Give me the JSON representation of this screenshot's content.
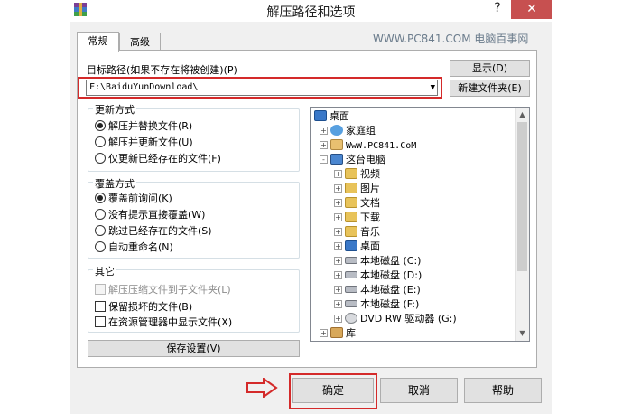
{
  "window": {
    "title": "解压路径和选项",
    "help_glyph": "?",
    "close_glyph": "✕"
  },
  "watermark": "WWW.PC841.COM 电脑百事网",
  "tabs": [
    {
      "label": "常规",
      "active": true
    },
    {
      "label": "高级",
      "active": false
    }
  ],
  "path": {
    "label": "目标路径(如果不存在将被创建)(P)",
    "value": "F:\\BaiduYunDownload\\",
    "show_button": "显示(D)",
    "new_folder_button": "新建文件夹(E)"
  },
  "update_mode": {
    "title": "更新方式",
    "options": [
      {
        "label": "解压并替换文件(R)",
        "selected": true
      },
      {
        "label": "解压并更新文件(U)",
        "selected": false
      },
      {
        "label": "仅更新已经存在的文件(F)",
        "selected": false
      }
    ]
  },
  "overwrite_mode": {
    "title": "覆盖方式",
    "options": [
      {
        "label": "覆盖前询问(K)",
        "selected": true
      },
      {
        "label": "没有提示直接覆盖(W)",
        "selected": false
      },
      {
        "label": "跳过已经存在的文件(S)",
        "selected": false
      },
      {
        "label": "自动重命名(N)",
        "selected": false
      }
    ]
  },
  "other": {
    "title": "其它",
    "options": [
      {
        "label": "解压压缩文件到子文件夹(L)",
        "checked": false,
        "disabled": true
      },
      {
        "label": "保留损坏的文件(B)",
        "checked": false,
        "disabled": false
      },
      {
        "label": "在资源管理器中显示文件(X)",
        "checked": false,
        "disabled": false
      }
    ]
  },
  "save_settings_button": "保存设置(V)",
  "tree": {
    "items": [
      {
        "label": "桌面",
        "icon": "desktop-icon"
      },
      {
        "label": "家庭组",
        "icon": "homegroup-icon",
        "expander": "+"
      },
      {
        "label": "WwW.PC841.CoM",
        "icon": "user-icon",
        "expander": "+"
      },
      {
        "label": "这台电脑",
        "icon": "computer-icon",
        "expander": "-"
      },
      {
        "label": "视频",
        "icon": "folder-icon",
        "expander": "+"
      },
      {
        "label": "图片",
        "icon": "folder-icon",
        "expander": "+"
      },
      {
        "label": "文档",
        "icon": "folder-icon",
        "expander": "+"
      },
      {
        "label": "下载",
        "icon": "folder-icon",
        "expander": "+"
      },
      {
        "label": "音乐",
        "icon": "folder-icon",
        "expander": "+"
      },
      {
        "label": "桌面",
        "icon": "folder-icon",
        "expander": "+"
      },
      {
        "label": "本地磁盘 (C:)",
        "icon": "drive-icon",
        "expander": "+"
      },
      {
        "label": "本地磁盘 (D:)",
        "icon": "drive-icon",
        "expander": "+"
      },
      {
        "label": "本地磁盘 (E:)",
        "icon": "drive-icon",
        "expander": "+"
      },
      {
        "label": "本地磁盘 (F:)",
        "icon": "drive-icon",
        "expander": "+"
      },
      {
        "label": "DVD RW 驱动器 (G:)",
        "icon": "dvd-icon",
        "expander": "+"
      },
      {
        "label": "库",
        "icon": "library-icon",
        "expander": "+"
      }
    ]
  },
  "buttons": {
    "ok": "确定",
    "cancel": "取消",
    "help": "帮助"
  },
  "colors": {
    "highlight_red": "#d42a2a",
    "close_button": "#c75050"
  }
}
